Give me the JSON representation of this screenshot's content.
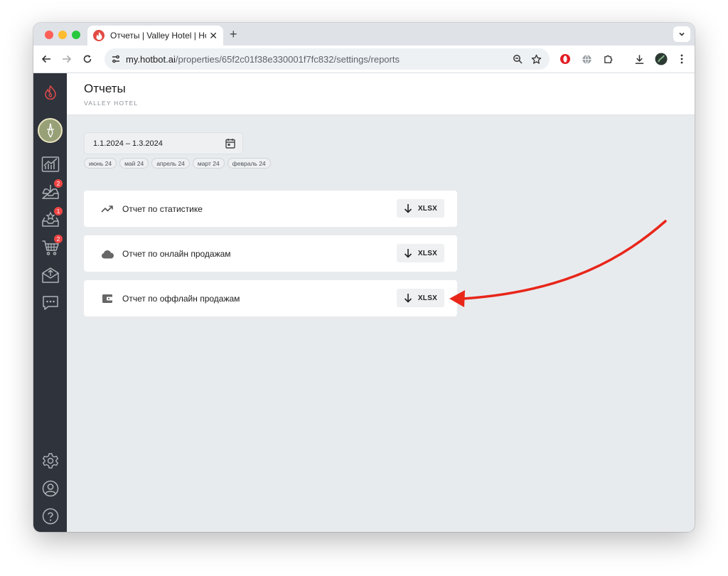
{
  "browser": {
    "tab_title": "Отчеты | Valley Hotel | Hotbot",
    "tab_close": "✕",
    "new_tab": "+",
    "url_host": "my.hotbot.ai",
    "url_path": "/properties/65f2c01f38e330001f7fc832/settings/reports"
  },
  "sidebar": {
    "badges": {
      "inbox": "2",
      "reviews": "1",
      "cart": "2"
    }
  },
  "header": {
    "title": "Отчеты",
    "subtitle": "VALLEY HOTEL"
  },
  "date_range": {
    "value": "1.1.2024 – 1.3.2024",
    "chips": [
      "июнь 24",
      "май 24",
      "апрель 24",
      "март 24",
      "февраль 24"
    ]
  },
  "reports": [
    {
      "icon": "trending-up-icon",
      "label": "Отчет по статистике",
      "button": "XLSX"
    },
    {
      "icon": "cloud-icon",
      "label": "Отчет по онлайн продажам",
      "button": "XLSX"
    },
    {
      "icon": "wallet-icon",
      "label": "Отчет по оффлайн продажам",
      "button": "XLSX"
    }
  ],
  "colors": {
    "sidebar_bg": "#2f333b",
    "content_bg": "#e8ebee",
    "badge": "#ef4545",
    "annotation_arrow": "#e8261a"
  }
}
